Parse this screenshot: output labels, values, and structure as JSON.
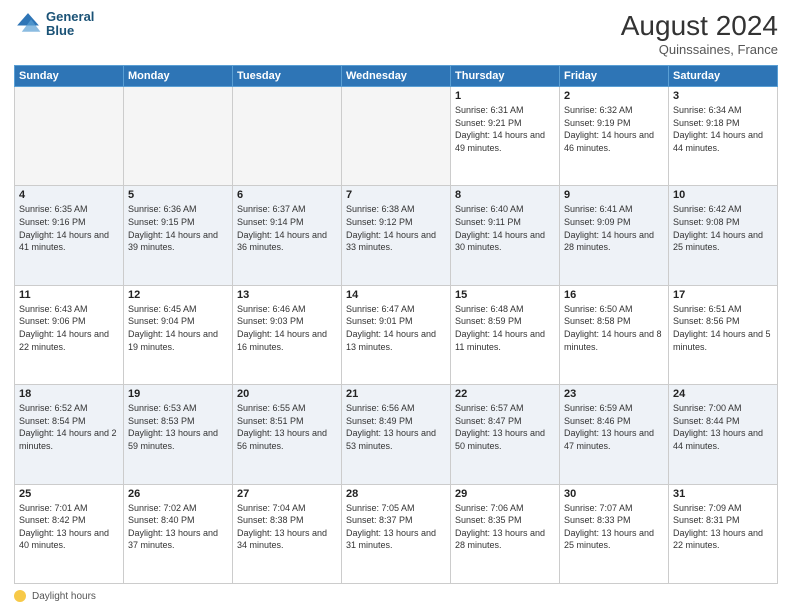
{
  "header": {
    "logo_line1": "General",
    "logo_line2": "Blue",
    "month_year": "August 2024",
    "location": "Quinssaines, France"
  },
  "weekdays": [
    "Sunday",
    "Monday",
    "Tuesday",
    "Wednesday",
    "Thursday",
    "Friday",
    "Saturday"
  ],
  "legend": {
    "label": "Daylight hours"
  },
  "weeks": [
    [
      {
        "day": "",
        "empty": true
      },
      {
        "day": "",
        "empty": true
      },
      {
        "day": "",
        "empty": true
      },
      {
        "day": "",
        "empty": true
      },
      {
        "day": "1",
        "sunrise": "6:31 AM",
        "sunset": "9:21 PM",
        "daylight": "14 hours and 49 minutes."
      },
      {
        "day": "2",
        "sunrise": "6:32 AM",
        "sunset": "9:19 PM",
        "daylight": "14 hours and 46 minutes."
      },
      {
        "day": "3",
        "sunrise": "6:34 AM",
        "sunset": "9:18 PM",
        "daylight": "14 hours and 44 minutes."
      }
    ],
    [
      {
        "day": "4",
        "sunrise": "6:35 AM",
        "sunset": "9:16 PM",
        "daylight": "14 hours and 41 minutes."
      },
      {
        "day": "5",
        "sunrise": "6:36 AM",
        "sunset": "9:15 PM",
        "daylight": "14 hours and 39 minutes."
      },
      {
        "day": "6",
        "sunrise": "6:37 AM",
        "sunset": "9:14 PM",
        "daylight": "14 hours and 36 minutes."
      },
      {
        "day": "7",
        "sunrise": "6:38 AM",
        "sunset": "9:12 PM",
        "daylight": "14 hours and 33 minutes."
      },
      {
        "day": "8",
        "sunrise": "6:40 AM",
        "sunset": "9:11 PM",
        "daylight": "14 hours and 30 minutes."
      },
      {
        "day": "9",
        "sunrise": "6:41 AM",
        "sunset": "9:09 PM",
        "daylight": "14 hours and 28 minutes."
      },
      {
        "day": "10",
        "sunrise": "6:42 AM",
        "sunset": "9:08 PM",
        "daylight": "14 hours and 25 minutes."
      }
    ],
    [
      {
        "day": "11",
        "sunrise": "6:43 AM",
        "sunset": "9:06 PM",
        "daylight": "14 hours and 22 minutes."
      },
      {
        "day": "12",
        "sunrise": "6:45 AM",
        "sunset": "9:04 PM",
        "daylight": "14 hours and 19 minutes."
      },
      {
        "day": "13",
        "sunrise": "6:46 AM",
        "sunset": "9:03 PM",
        "daylight": "14 hours and 16 minutes."
      },
      {
        "day": "14",
        "sunrise": "6:47 AM",
        "sunset": "9:01 PM",
        "daylight": "14 hours and 13 minutes."
      },
      {
        "day": "15",
        "sunrise": "6:48 AM",
        "sunset": "8:59 PM",
        "daylight": "14 hours and 11 minutes."
      },
      {
        "day": "16",
        "sunrise": "6:50 AM",
        "sunset": "8:58 PM",
        "daylight": "14 hours and 8 minutes."
      },
      {
        "day": "17",
        "sunrise": "6:51 AM",
        "sunset": "8:56 PM",
        "daylight": "14 hours and 5 minutes."
      }
    ],
    [
      {
        "day": "18",
        "sunrise": "6:52 AM",
        "sunset": "8:54 PM",
        "daylight": "14 hours and 2 minutes."
      },
      {
        "day": "19",
        "sunrise": "6:53 AM",
        "sunset": "8:53 PM",
        "daylight": "13 hours and 59 minutes."
      },
      {
        "day": "20",
        "sunrise": "6:55 AM",
        "sunset": "8:51 PM",
        "daylight": "13 hours and 56 minutes."
      },
      {
        "day": "21",
        "sunrise": "6:56 AM",
        "sunset": "8:49 PM",
        "daylight": "13 hours and 53 minutes."
      },
      {
        "day": "22",
        "sunrise": "6:57 AM",
        "sunset": "8:47 PM",
        "daylight": "13 hours and 50 minutes."
      },
      {
        "day": "23",
        "sunrise": "6:59 AM",
        "sunset": "8:46 PM",
        "daylight": "13 hours and 47 minutes."
      },
      {
        "day": "24",
        "sunrise": "7:00 AM",
        "sunset": "8:44 PM",
        "daylight": "13 hours and 44 minutes."
      }
    ],
    [
      {
        "day": "25",
        "sunrise": "7:01 AM",
        "sunset": "8:42 PM",
        "daylight": "13 hours and 40 minutes."
      },
      {
        "day": "26",
        "sunrise": "7:02 AM",
        "sunset": "8:40 PM",
        "daylight": "13 hours and 37 minutes."
      },
      {
        "day": "27",
        "sunrise": "7:04 AM",
        "sunset": "8:38 PM",
        "daylight": "13 hours and 34 minutes."
      },
      {
        "day": "28",
        "sunrise": "7:05 AM",
        "sunset": "8:37 PM",
        "daylight": "13 hours and 31 minutes."
      },
      {
        "day": "29",
        "sunrise": "7:06 AM",
        "sunset": "8:35 PM",
        "daylight": "13 hours and 28 minutes."
      },
      {
        "day": "30",
        "sunrise": "7:07 AM",
        "sunset": "8:33 PM",
        "daylight": "13 hours and 25 minutes."
      },
      {
        "day": "31",
        "sunrise": "7:09 AM",
        "sunset": "8:31 PM",
        "daylight": "13 hours and 22 minutes."
      }
    ]
  ]
}
